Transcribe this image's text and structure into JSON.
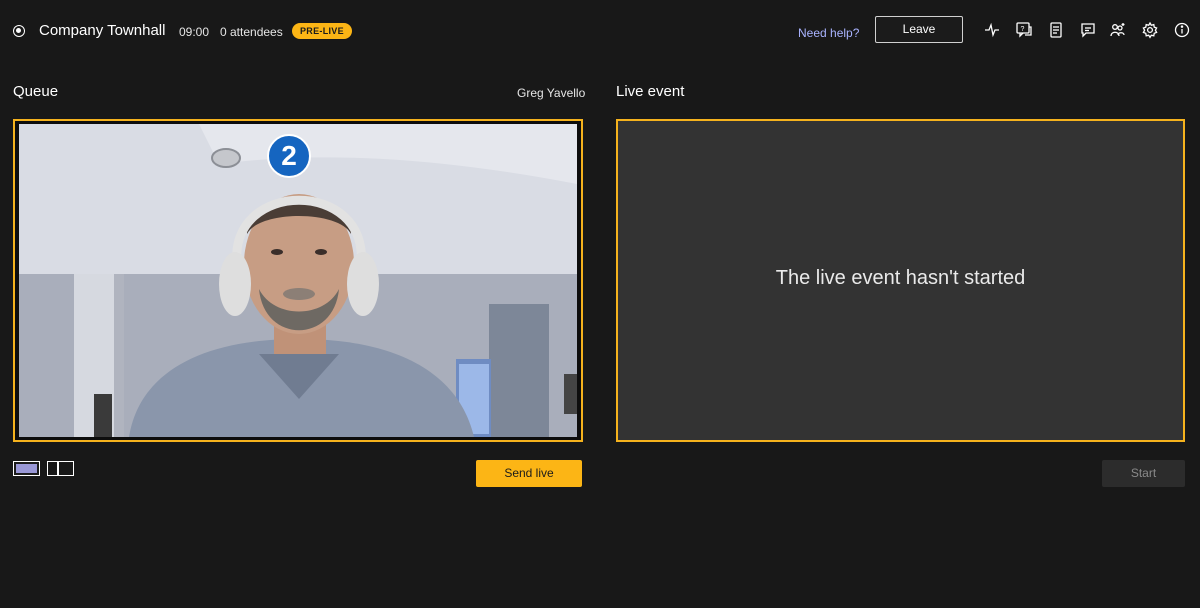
{
  "header": {
    "title": "Company Townhall",
    "time": "09:00",
    "attendees": "0 attendees",
    "status_badge": "PRE-LIVE",
    "help_link": "Need help?",
    "leave_label": "Leave",
    "icons": [
      "health-icon",
      "qna-icon",
      "notes-icon",
      "chat-icon",
      "people-icon",
      "settings-icon",
      "info-icon"
    ]
  },
  "queue": {
    "label": "Queue",
    "presenter_name": "Greg Yavello",
    "badge_number": "2",
    "send_live_label": "Send live"
  },
  "live": {
    "label": "Live event",
    "status_message": "The live event hasn't started",
    "start_label": "Start"
  },
  "colors": {
    "accent": "#fcb515",
    "frame": "#f5b21d",
    "link": "#a9b3ff",
    "background": "#181818",
    "badge_blue": "#1565c0"
  }
}
